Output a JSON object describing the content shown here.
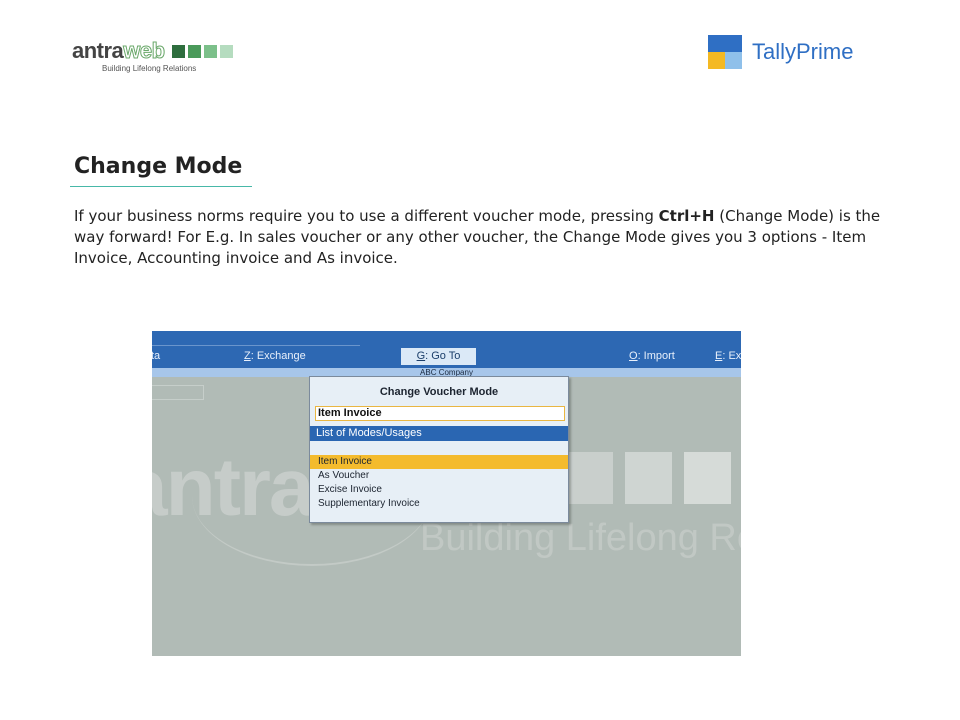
{
  "brand": {
    "antra_word_part1": "antra",
    "antra_word_part2": "web",
    "antra_tagline": "Building Lifelong Relations",
    "antra_square_colors": [
      "#2e6e3e",
      "#4a9a5a",
      "#7cc08a",
      "#b5dcbf"
    ],
    "tally_text": "TallyPrime"
  },
  "content": {
    "title": "Change Mode",
    "intro_before": "If your business norms require you to use a different voucher mode, pressing ",
    "intro_key": "Ctrl+H",
    "intro_after": " (Change Mode) is the way forward! For E.g. In sales voucher or any other voucher, the Change Mode gives you 3 options - Item Invoice, Accounting invoice and As invoice."
  },
  "screenshot": {
    "topbar": {
      "btn_ta": "ta",
      "exchange_key": "Z",
      "exchange_label": ": Exchange",
      "goto_key": "G",
      "goto_label": ": Go To",
      "import_key": "O",
      "import_label": ": Import",
      "ex_key": "E",
      "ex_label": ": Ex"
    },
    "company_name": "ABC Company",
    "watermark": {
      "word": "antraweb",
      "tagline": "Building Lifelong Relations"
    },
    "dialog": {
      "title": "Change Voucher Mode",
      "input_value": "Item Invoice",
      "list_header": "List of Modes/Usages",
      "items": [
        {
          "label": "Item Invoice",
          "selected": true
        },
        {
          "label": "As Voucher",
          "selected": false
        },
        {
          "label": "Excise Invoice",
          "selected": false
        },
        {
          "label": "Supplementary Invoice",
          "selected": false
        }
      ]
    }
  },
  "colors": {
    "accent_teal": "#47b8a8",
    "tally_blue": "#2d68b3",
    "highlight_yellow": "#f4bb2d"
  }
}
